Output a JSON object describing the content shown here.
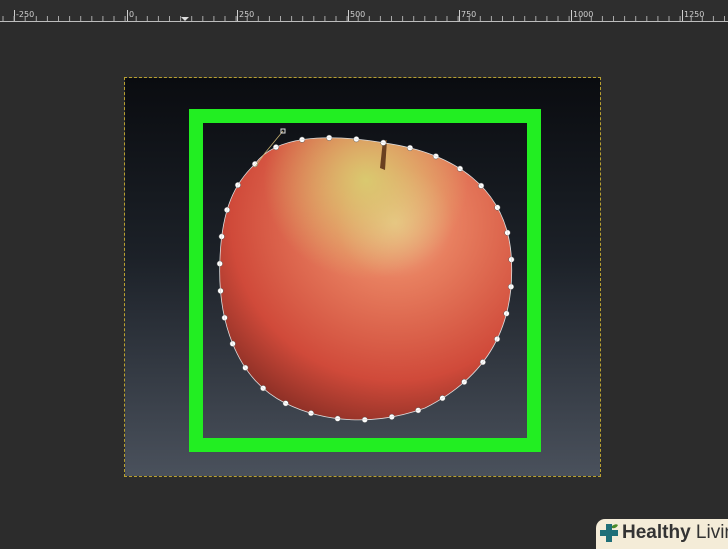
{
  "ruler": {
    "labels": [
      "-250",
      "0",
      "250",
      "500",
      "750",
      "1000",
      "1250"
    ]
  },
  "canvas": {
    "subject": "apple",
    "highlight_color": "#22ee22"
  },
  "watermark": {
    "brand_bold": "Healthy",
    "brand_rest": "Living"
  }
}
